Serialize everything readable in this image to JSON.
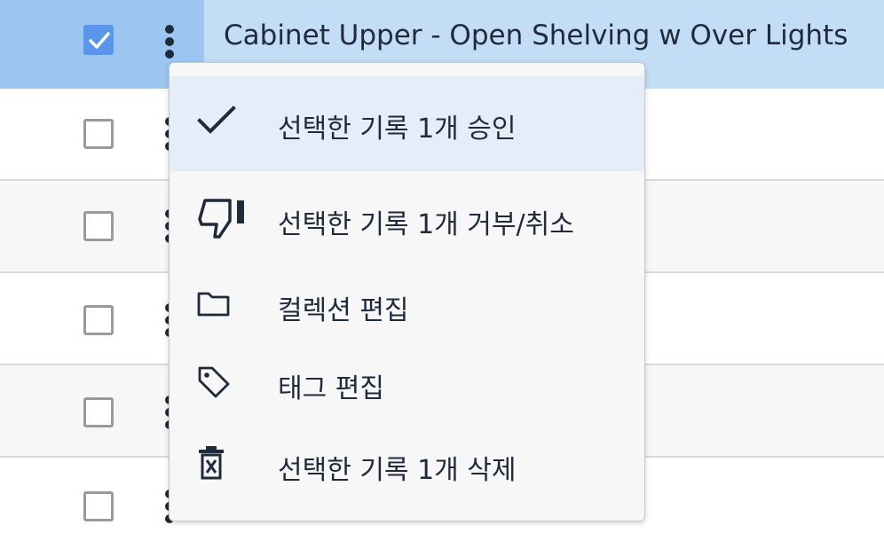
{
  "rows": [
    {
      "title": "Cabinet Upper - Open Shelving w Over Lights",
      "checked": true
    },
    {
      "title": "",
      "checked": false
    },
    {
      "title": "",
      "checked": false
    },
    {
      "title": "",
      "checked": false
    },
    {
      "title": "",
      "checked": false
    },
    {
      "title": "",
      "checked": false
    }
  ],
  "menu": {
    "approve": {
      "label": "선택한 기록 1개 승인",
      "icon": "checkmark-icon"
    },
    "reject": {
      "label": "선택한 기록 1개 거부/취소",
      "icon": "thumbs-down-icon"
    },
    "edit_collection": {
      "label": "컬렉션 편집",
      "icon": "folder-icon"
    },
    "edit_tags": {
      "label": "태그 편집",
      "icon": "tag-icon"
    },
    "delete": {
      "label": "선택한 기록 1개 삭제",
      "icon": "trash-icon"
    }
  },
  "colors": {
    "selected_row": "#c3ddf7",
    "checkbox_checked": "#5a95ec",
    "menu_active": "#e5eef8"
  }
}
